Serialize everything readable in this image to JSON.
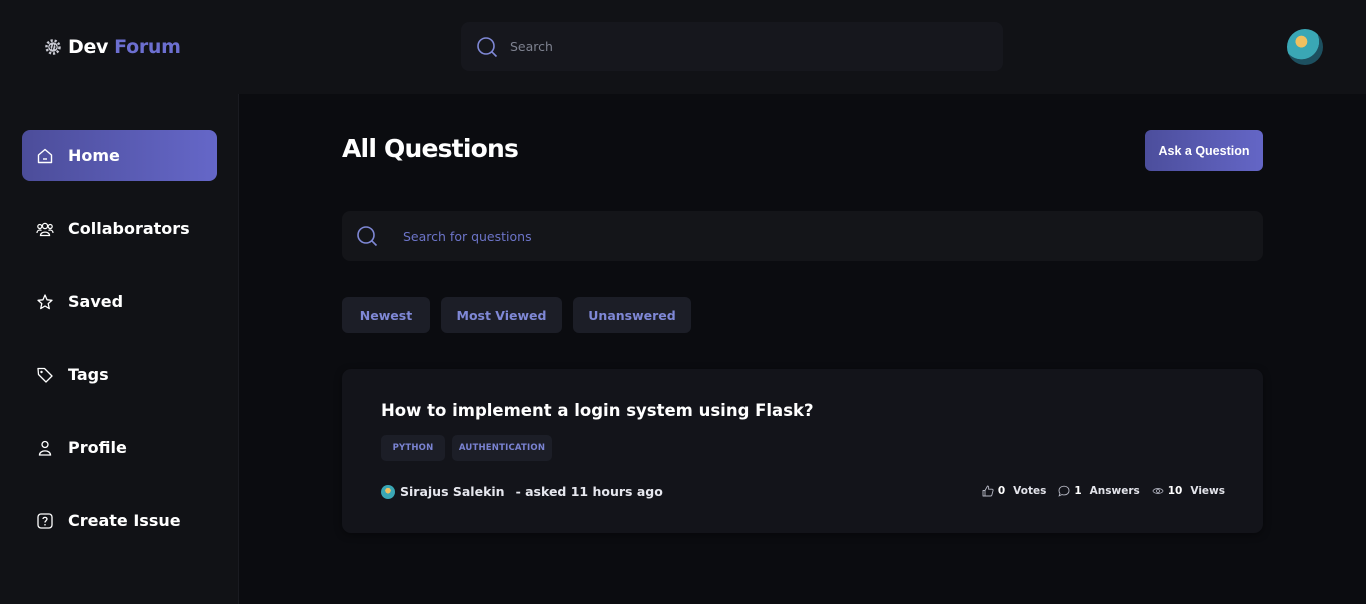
{
  "header": {
    "brand_part1": "Dev",
    "brand_part2": "Forum",
    "search_placeholder": "Search",
    "logo_icon": "code-gear-icon"
  },
  "sidebar": {
    "items": [
      {
        "label": "Home",
        "icon": "home-icon",
        "active": true
      },
      {
        "label": "Collaborators",
        "icon": "users-icon",
        "active": false
      },
      {
        "label": "Saved",
        "icon": "star-icon",
        "active": false
      },
      {
        "label": "Tags",
        "icon": "tag-icon",
        "active": false
      },
      {
        "label": "Profile",
        "icon": "user-icon",
        "active": false
      },
      {
        "label": "Create Issue",
        "icon": "question-icon",
        "active": false
      }
    ]
  },
  "main": {
    "title": "All Questions",
    "ask_button": "Ask a Question",
    "search_placeholder": "Search for questions",
    "filters": [
      "Newest",
      "Most Viewed",
      "Unanswered"
    ]
  },
  "questions": [
    {
      "title": "How to implement a login system using Flask?",
      "tags": [
        "PYTHON",
        "AUTHENTICATION"
      ],
      "author": "Sirajus Salekin",
      "asked": "- asked 11 hours ago",
      "votes": "0",
      "votes_label": "Votes",
      "answers": "1",
      "answers_label": "Answers",
      "views": "10",
      "views_label": "Views"
    }
  ],
  "colors": {
    "accent": "#6567c8",
    "background": "#0b0c10",
    "surface": "#111216"
  }
}
